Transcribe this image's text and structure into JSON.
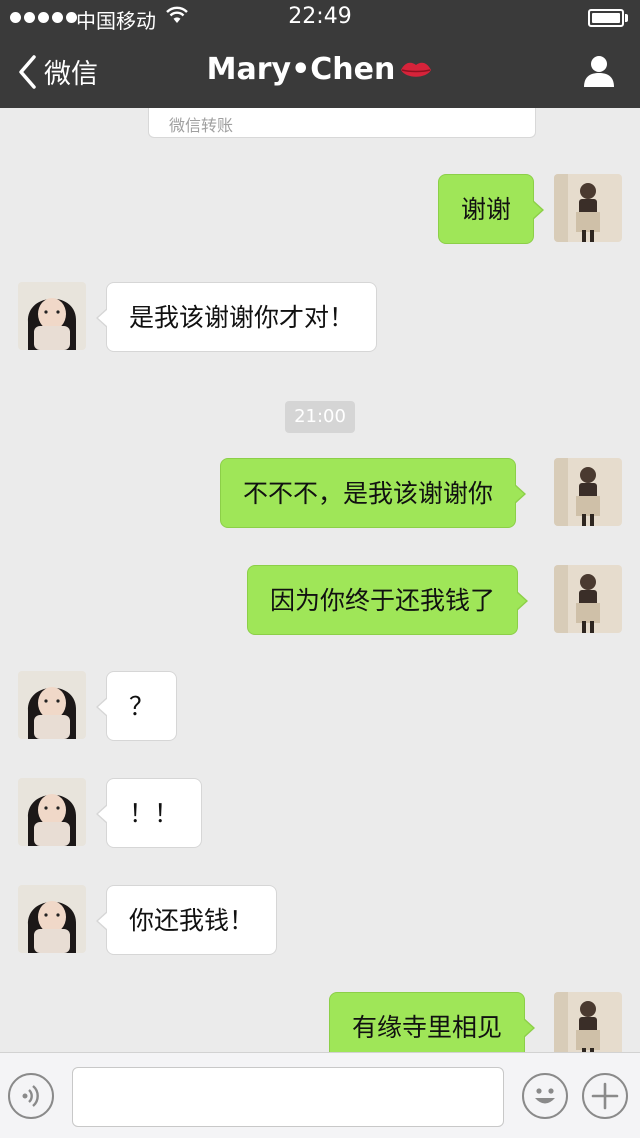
{
  "status_bar": {
    "carrier": "中国移动",
    "time": "22:49",
    "battery_level": 1.0,
    "icons": [
      "signal-dots-icon",
      "wifi-icon",
      "battery-icon"
    ]
  },
  "nav": {
    "back_label": "微信",
    "title": "Mary•Chen",
    "title_emoji": "lips-icon",
    "back_icon": "chevron-left-icon",
    "right_icon": "person-icon"
  },
  "transfer_card": {
    "label": "微信转账"
  },
  "timestamp": "21:00",
  "messages": [
    {
      "side": "out",
      "text": "谢谢"
    },
    {
      "side": "in",
      "text": "是我该谢谢你才对！"
    },
    {
      "side": "out",
      "text": "不不不，是我该谢谢你"
    },
    {
      "side": "out",
      "text": "因为你终于还我钱了"
    },
    {
      "side": "in",
      "text": "？"
    },
    {
      "side": "in",
      "text": "！！"
    },
    {
      "side": "in",
      "text": "你还我钱！"
    },
    {
      "side": "out",
      "text": "有缘寺里相见"
    }
  ],
  "input_bar": {
    "placeholder": "",
    "icons": [
      "voice-icon",
      "emoji-icon",
      "plus-icon"
    ]
  },
  "colors": {
    "header_bg": "#3a3a3a",
    "chat_bg": "#ebebeb",
    "outgoing_bubble": "#9fe658",
    "incoming_bubble": "#ffffff",
    "lips": "#d6233a"
  }
}
